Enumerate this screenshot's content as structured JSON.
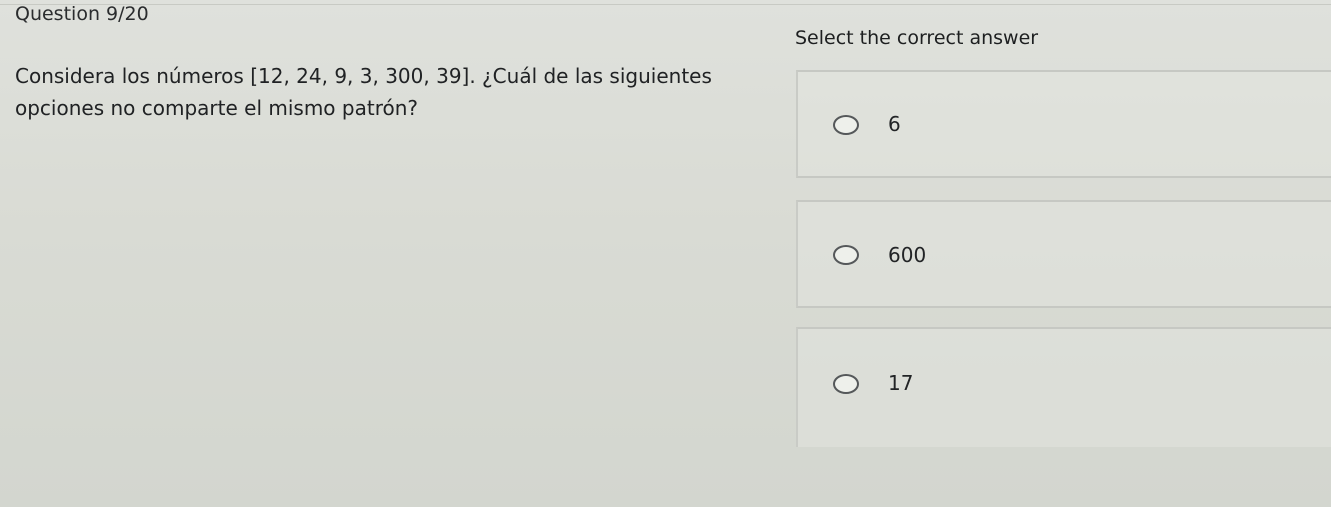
{
  "quiz": {
    "counter": "Question 9/20",
    "question": "Considera los números [12, 24, 9, 3, 300, 39]. ¿Cuál de las siguientes opciones no comparte el mismo patrón?",
    "instruction": "Select the correct answer",
    "options": [
      {
        "label": "6"
      },
      {
        "label": "600"
      },
      {
        "label": "17"
      }
    ]
  }
}
